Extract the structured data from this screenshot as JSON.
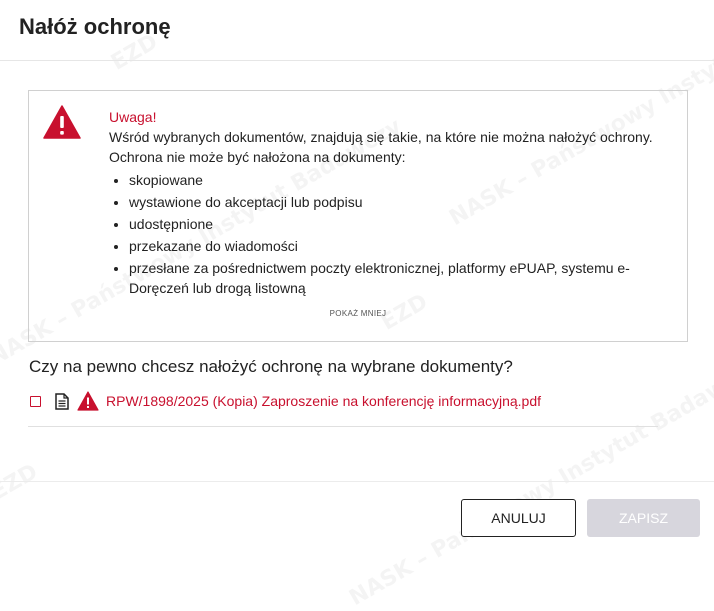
{
  "dialog": {
    "title": "Nałóż ochronę"
  },
  "watermark": {
    "text": "NASK – Państwowy Instytut Badawczy",
    "logo": "EZD"
  },
  "warning": {
    "heading": "Uwaga!",
    "line1": "Wśród wybranych dokumentów, znajdują się takie, na które nie można nałożyć ochrony.",
    "line2": "Ochrona nie może być nałożona na dokumenty:",
    "items": [
      "skopiowane",
      "wystawione do akceptacji lub podpisu",
      "udostępnione",
      "przekazane do wiadomości",
      "przesłane za pośrednictwem poczty elektronicznej, platformy ePUAP, systemu e-Doręczeń lub drogą listowną"
    ],
    "toggle_label": "POKAŻ MNIEJ",
    "icon": "warning-triangle-icon"
  },
  "question": "Czy na pewno chcesz nałożyć ochronę na wybrane dokumenty?",
  "document": {
    "label": "RPW/1898/2025 (Kopia) Zaproszenie na konferencję informacyjną.pdf",
    "checked": false
  },
  "buttons": {
    "cancel": "ANULUJ",
    "save": "ZAPISZ"
  },
  "colors": {
    "accent": "#c8102e",
    "disabled": "#d7d6dd"
  }
}
